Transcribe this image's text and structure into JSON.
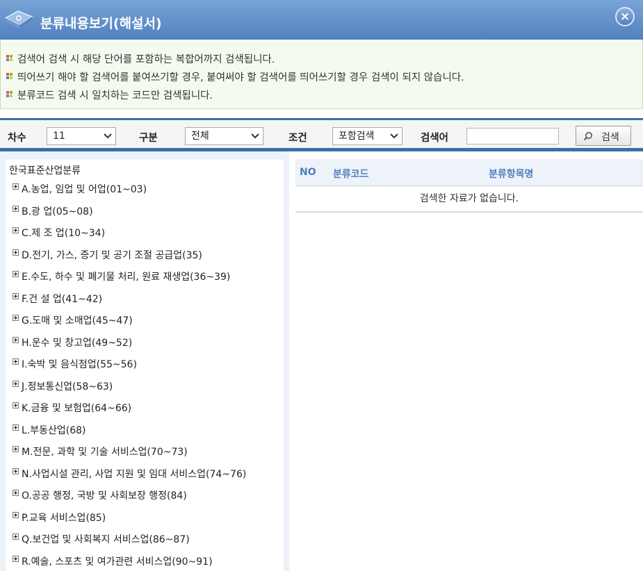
{
  "window": {
    "title": "분류내용보기(해설서)",
    "close_label": "×"
  },
  "notice": {
    "items": [
      "검색어 검색 시 해당 단어를 포함하는 복합어까지 검색됩니다.",
      "띄어쓰기 해야 할 검색어를 붙여쓰기할 경우, 붙여써야 할 검색어를 띄어쓰기할 경우 검색이 되지 않습니다.",
      "분류코드 검색 시 일치하는 코드만 검색됩니다."
    ]
  },
  "search": {
    "edition_label": "차수",
    "edition_value": "11",
    "category_label": "구분",
    "category_value": "전체",
    "condition_label": "조건",
    "condition_value": "포함검색",
    "keyword_label": "검색어",
    "keyword_value": "",
    "button_label": "검색"
  },
  "tree": {
    "root": "한국표준산업분류",
    "items": [
      "A.농업, 임업 및 어업(01~03)",
      "B.광 업(05~08)",
      "C.제 조 업(10~34)",
      "D.전기, 가스, 증기 및 공기 조절 공급업(35)",
      "E.수도, 하수 및 폐기물 처리, 원료 재생업(36~39)",
      "F.건 설 업(41~42)",
      "G.도매 및 소매업(45~47)",
      "H.운수 및 창고업(49~52)",
      "I.숙박 및 음식점업(55~56)",
      "J.정보통신업(58~63)",
      "K.금융 및 보험업(64~66)",
      "L.부동산업(68)",
      "M.전문, 과학 및 기술 서비스업(70~73)",
      "N.사업시설 관리, 사업 지원 및 임대 서비스업(74~76)",
      "O.공공 행정, 국방 및 사회보장 행정(84)",
      "P.교육 서비스업(85)",
      "Q.보건업 및 사회복지 서비스업(86~87)",
      "R.예술, 스포츠 및 여가관련 서비스업(90~91)"
    ]
  },
  "results": {
    "columns": [
      "NO",
      "분류코드",
      "분류항목명"
    ],
    "empty_message": "검색한 자료가 없습니다."
  },
  "colors": {
    "title_bar": "#4f80c0",
    "accent_blue": "#3a6fae",
    "notice_bg": "#f4faef",
    "header_text": "#4f7fc1"
  }
}
